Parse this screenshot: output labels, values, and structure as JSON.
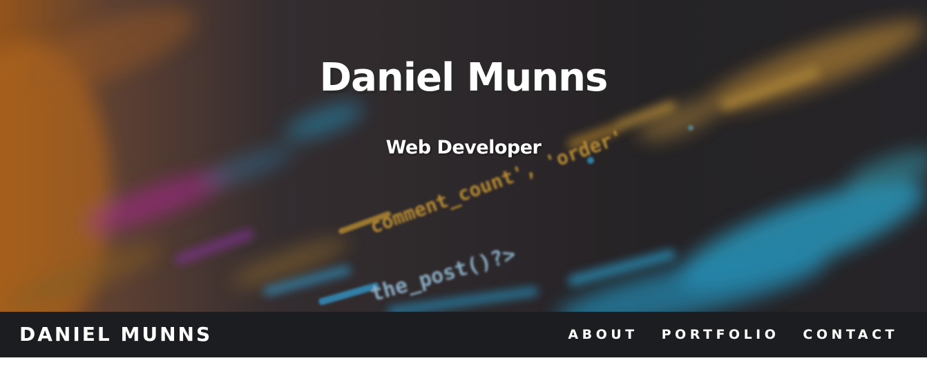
{
  "hero": {
    "title": "Daniel Munns",
    "subtitle": "Web Developer",
    "background_code_fragments": [
      "comment_count', 'order'",
      "the_post()?>"
    ]
  },
  "navbar": {
    "brand": "DANIEL MUNNS",
    "links": [
      {
        "label": "ABOUT"
      },
      {
        "label": "PORTFOLIO"
      },
      {
        "label": "CONTACT"
      }
    ]
  },
  "colors": {
    "navbar_bg": "#1c1d21",
    "hero_text": "#ffffff",
    "code_yellow": "#e0a93a",
    "code_cyan": "#2fb4e0",
    "code_magenta": "#c0339b",
    "code_orange": "#c87a2a"
  }
}
